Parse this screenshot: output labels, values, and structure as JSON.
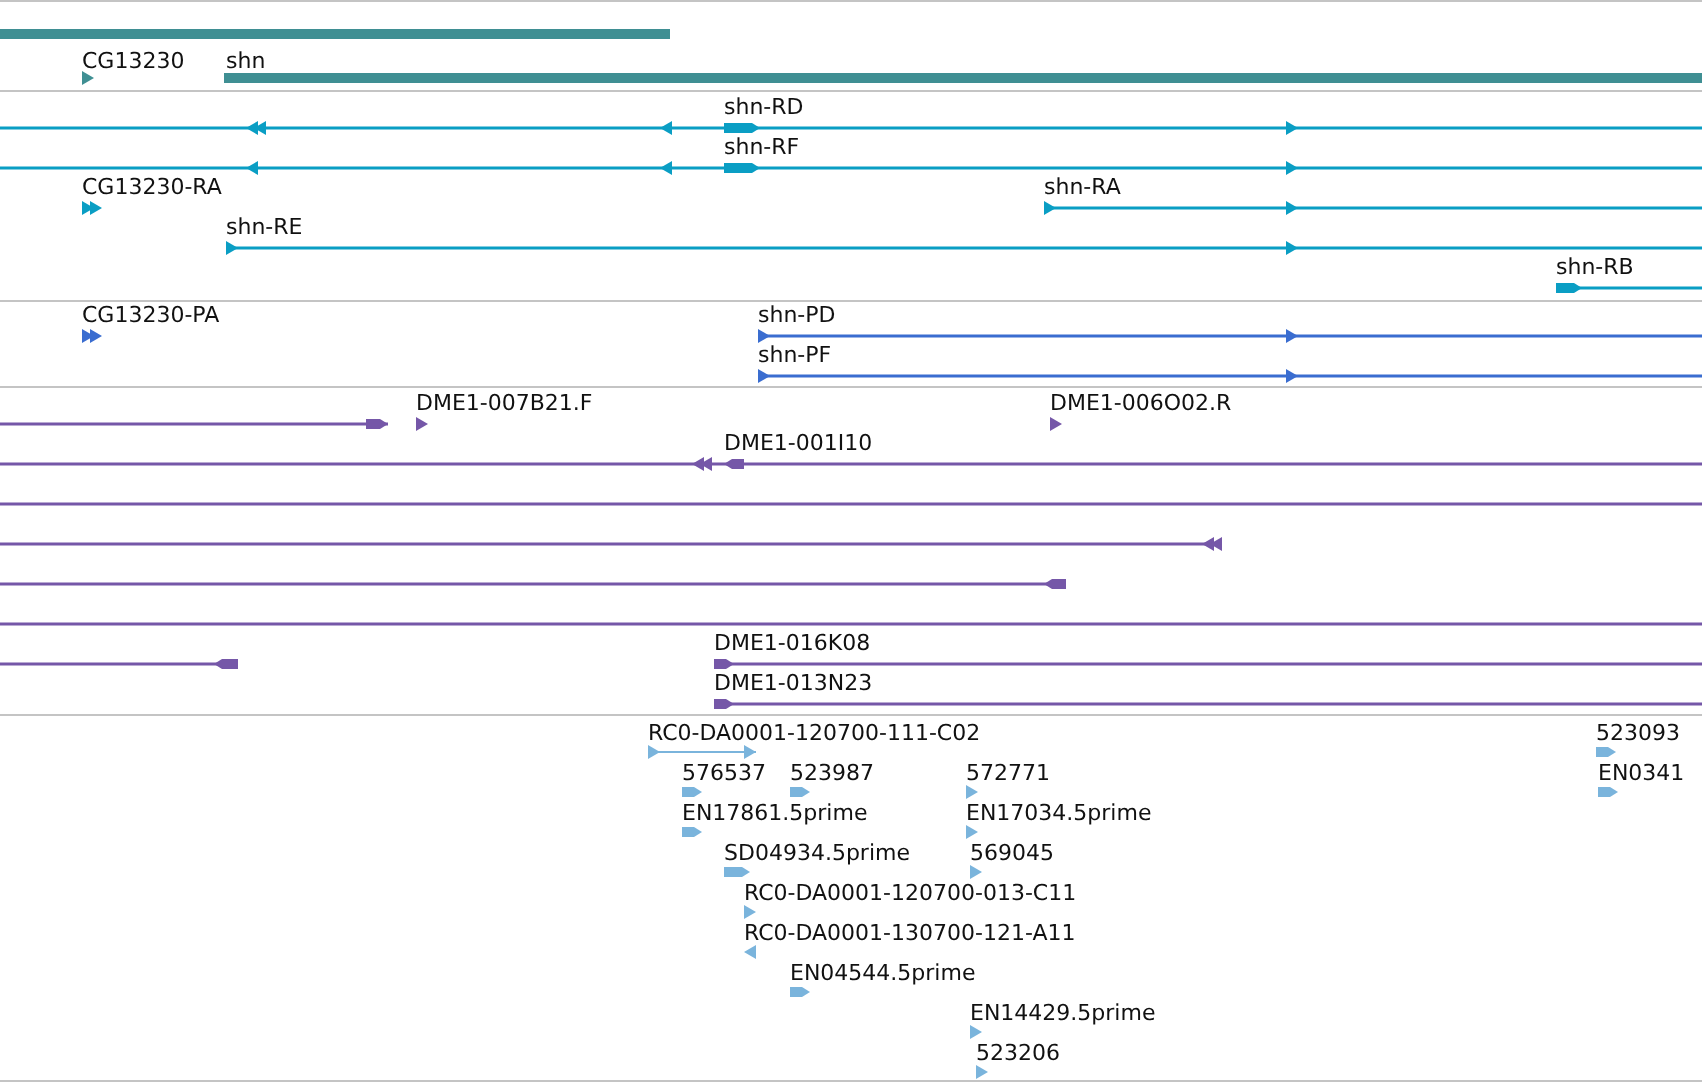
{
  "tracks": [
    {
      "color": "#3f8f93",
      "features": [
        {
          "kind": "gene"
        },
        {
          "kind": "gene",
          "label": "CG13230"
        },
        {
          "kind": "gene",
          "label": "shn"
        }
      ]
    },
    {
      "color": "#0a9ec4",
      "features": [
        {
          "kind": "transcript",
          "label": "shn-RD"
        },
        {
          "kind": "transcript",
          "label": "shn-RF"
        },
        {
          "kind": "transcript",
          "label": "CG13230-RA"
        },
        {
          "kind": "transcript",
          "label": "shn-RA"
        },
        {
          "kind": "transcript",
          "label": "shn-RE"
        },
        {
          "kind": "transcript",
          "label": "shn-RB"
        }
      ]
    },
    {
      "color": "#3a6dd0",
      "features": [
        {
          "kind": "protein",
          "label": "CG13230-PA"
        },
        {
          "kind": "protein",
          "label": "shn-PD"
        },
        {
          "kind": "protein",
          "label": "shn-PF"
        }
      ]
    },
    {
      "color": "#7557a8",
      "features": [
        {
          "kind": "clone"
        },
        {
          "kind": "clone",
          "label": "DME1-007B21.F"
        },
        {
          "kind": "clone",
          "label": "DME1-006O02.R"
        },
        {
          "kind": "clone",
          "label": "DME1-001I10"
        },
        {
          "kind": "clone"
        },
        {
          "kind": "clone"
        },
        {
          "kind": "clone"
        },
        {
          "kind": "clone"
        },
        {
          "kind": "clone"
        },
        {
          "kind": "clone",
          "label": "DME1-016K08"
        },
        {
          "kind": "clone",
          "label": "DME1-013N23"
        }
      ]
    },
    {
      "color": "#7ab4dc",
      "features": [
        {
          "kind": "est",
          "label": "RC0-DA0001-120700-111-C02"
        },
        {
          "kind": "est",
          "label": "576537"
        },
        {
          "kind": "est",
          "label": "523987"
        },
        {
          "kind": "est",
          "label": "572771"
        },
        {
          "kind": "est",
          "label": "EN17861.5prime"
        },
        {
          "kind": "est",
          "label": "EN17034.5prime"
        },
        {
          "kind": "est",
          "label": "SD04934.5prime"
        },
        {
          "kind": "est",
          "label": "569045"
        },
        {
          "kind": "est",
          "label": "RC0-DA0001-120700-013-C11"
        },
        {
          "kind": "est",
          "label": "RC0-DA0001-130700-121-A11"
        },
        {
          "kind": "est",
          "label": "EN04544.5prime"
        },
        {
          "kind": "est",
          "label": "EN14429.5prime"
        },
        {
          "kind": "est",
          "label": "523206"
        },
        {
          "kind": "est",
          "label": "523093"
        },
        {
          "kind": "est",
          "label": "EN0341"
        }
      ]
    }
  ]
}
